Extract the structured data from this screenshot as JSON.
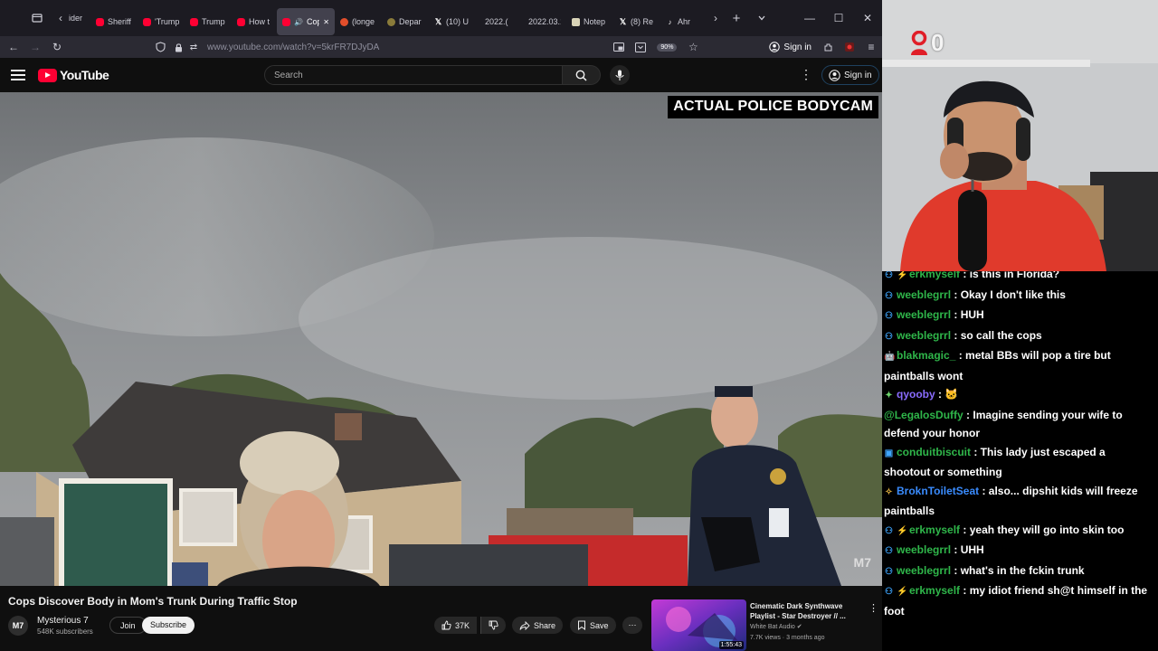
{
  "browser": {
    "tabs": [
      {
        "label": "Sheriff",
        "fav": "yt"
      },
      {
        "label": "'Trump",
        "fav": "yt"
      },
      {
        "label": "Trump",
        "fav": "yt"
      },
      {
        "label": "How t",
        "fav": "yt"
      },
      {
        "label": "Cop",
        "fav": "yt",
        "active": true
      },
      {
        "label": "(longe",
        "fav": "red"
      },
      {
        "label": "Depar",
        "fav": "gov"
      },
      {
        "label": "(10) U",
        "fav": "x"
      },
      {
        "label": "2022.(",
        "fav": "none"
      },
      {
        "label": "2022.03.1",
        "fav": "none"
      },
      {
        "label": "Notep",
        "fav": "note"
      },
      {
        "label": "(8) Re",
        "fav": "x"
      },
      {
        "label": "Ahr",
        "fav": "tk"
      }
    ],
    "first_tab_fragment": "ider",
    "url_prefix": "www.youtube.com",
    "url_rest": "/watch?v=5krFR7DJyDA",
    "zoom": "90%",
    "signin_label": "Sign in"
  },
  "youtube": {
    "logo_text": "YouTube",
    "search_placeholder": "Search",
    "signin_label": "Sign in"
  },
  "video": {
    "overlay_label": "ACTUAL POLICE BODYCAM",
    "watermark": "M7",
    "title": "Cops Discover Body in Mom's Trunk During Traffic Stop"
  },
  "channel": {
    "avatar_text": "M7",
    "name": "Mysterious 7",
    "subscribers": "548K subscribers",
    "join_label": "Join",
    "subscribe_label": "Subscribe"
  },
  "actions": {
    "likes": "37K",
    "share_label": "Share",
    "save_label": "Save"
  },
  "recommendation": {
    "title": "Cinematic Dark Synthwave Playlist - Star Destroyer // ...",
    "channel": "White Bat Audio",
    "meta": "7.7K views · 3 months ago",
    "duration": "1:55:43"
  },
  "webcam": {
    "counter": "0"
  },
  "chat": {
    "messages": [
      {
        "badge": "person",
        "user": "erkmyself",
        "user_color": "#2fb64a",
        "text": "is this in Florida?"
      },
      {
        "badge": "person",
        "user": "weeblegrrl",
        "user_color": "#2fb64a",
        "text": "Okay I don't like this"
      },
      {
        "badge": "person",
        "user": "weeblegrrl",
        "user_color": "#2fb64a",
        "text": "HUH"
      },
      {
        "badge": "person",
        "user": "weeblegrrl",
        "user_color": "#2fb64a",
        "text": "so call the cops"
      },
      {
        "badge": "robot",
        "user": "blakmagic_",
        "user_color": "#2fb64a",
        "text": "metal BBs will pop a tire but paintballs wont"
      },
      {
        "badge": "star",
        "user": "qyooby",
        "user_color": "#8a6cff",
        "text": "🐱"
      },
      {
        "badge": "none",
        "user": "@LegalosDuffy",
        "user_color": "#2fb64a",
        "text": "Imagine sending your wife to defend your honor"
      },
      {
        "badge": "monitor",
        "user": "conduitbiscuit",
        "user_color": "#2fb64a",
        "text": "This lady just escaped a shootout or something"
      },
      {
        "badge": "wizard",
        "user": "BroknToiletSeat",
        "user_color": "#3a8cff",
        "text": "also... dipshit kids will freeze paintballs"
      },
      {
        "badge": "person",
        "user": "erkmyself",
        "user_color": "#2fb64a",
        "text": "yeah they will go into skin too"
      },
      {
        "badge": "person",
        "user": "weeblegrrl",
        "user_color": "#2fb64a",
        "text": "UHH"
      },
      {
        "badge": "person",
        "user": "weeblegrrl",
        "user_color": "#2fb64a",
        "text": "what's in the fckin trunk"
      },
      {
        "badge": "person",
        "user": "erkmyself",
        "user_color": "#2fb64a",
        "text": "my idiot friend sh@t himself in the foot"
      }
    ]
  },
  "colors": {
    "yt_red": "#ff0033",
    "chat_green": "#2fb64a",
    "browser_tabbar": "#1c1b22",
    "browser_navbar": "#2b2a33"
  }
}
